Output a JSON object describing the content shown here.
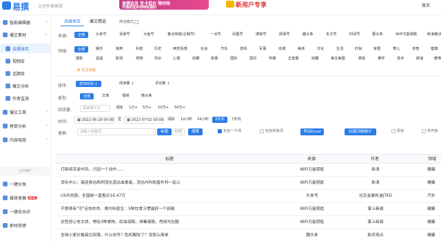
{
  "header": {
    "logo_text": "易撰",
    "slogan": "让创作更高效",
    "banner_line1": "易撰会员 年卡低价 限时抢",
    "banner_line2": "开通即送多项特权福利",
    "banner2_text": "新用户专享",
    "home_link": "首页"
  },
  "sidebar": {
    "items": [
      {
        "label": "智能编辑器",
        "arrow": "›"
      },
      {
        "label": "爆文素材",
        "arrow": "⌄"
      },
      {
        "label": "自媒体库"
      },
      {
        "label": "视频库"
      },
      {
        "label": "话题库"
      },
      {
        "label": "爆文分析"
      },
      {
        "label": "作者监测"
      },
      {
        "label": "爆文工具",
        "arrow": "›"
      },
      {
        "label": "榜单分析",
        "arrow": "›"
      },
      {
        "label": "内容电商",
        "arrow": "›"
      }
    ],
    "section_label": "合作推广",
    "promo_items": [
      {
        "label": "一键分发"
      },
      {
        "label": "媒体发稿",
        "badge": "NEW"
      },
      {
        "label": "一键去水印"
      },
      {
        "label": "即时热榜"
      }
    ]
  },
  "tabs": [
    {
      "label": "自媒体库"
    },
    {
      "label": "爆文精选"
    },
    {
      "label": "简洁模式"
    }
  ],
  "filters": {
    "source_label": "来源:",
    "sources": [
      "全部",
      "头条号",
      "百家号",
      "大鱼号",
      "看点快报(企鹅号)",
      "一点号",
      "凤凰号",
      "搜狐号",
      "网易号",
      "趣头条",
      "东方号",
      "时间号",
      "惠头条",
      "WiFi万能钥匙",
      "新浪看点"
    ],
    "domain_label": "领域:",
    "domains_row1": [
      "全部",
      "娱乐",
      "搞笑",
      "科技",
      "历史",
      "两性情感",
      "社会",
      "汽车",
      "游戏",
      "军事",
      "动漫",
      "美食",
      "文化",
      "生活",
      "时尚",
      "家居",
      "育儿",
      "体育",
      "健康"
    ],
    "domains_row2": [
      "摄影",
      "星座",
      "职场",
      "宠物",
      "风水",
      "心理",
      "收藏",
      "故事",
      "国际",
      "国内",
      "传媒",
      "正能量",
      "收藏",
      "美文美图",
      "移民",
      "佛学",
      "技术",
      "辟谣",
      "教育"
    ],
    "follow_domain": "关注领域",
    "sort_label": "排序:",
    "sorts": [
      "发布时间",
      "阅读量",
      "评论数"
    ],
    "type_label": "类型:",
    "types": [
      "全部",
      "文章",
      "视频",
      "微头条"
    ],
    "read_label": "阅读量:",
    "read_placeholder": "阅读量大于",
    "read_clear": "清除",
    "read_options": [
      "1万+",
      "5万+",
      "10万+",
      "50万+"
    ],
    "time_label": "时间:",
    "time_start": "2022-06-29 00:00",
    "time_sep": "至",
    "time_end": "2022-07-02 00:00",
    "time_clear": "清除",
    "time_options": [
      "12小时",
      "24小时",
      "3天内",
      "7天内"
    ],
    "search_label": "搜索:",
    "search_placeholder": "请输入关键词",
    "search_opt_title": "标题",
    "search_opt_tag": "标签",
    "search_button": "搜索",
    "include_one": "包含一个词",
    "include_all": "包含所有词",
    "export_button": "导出Excel",
    "keyword_stats_button": "标题词频统计",
    "original": "原创",
    "unopened": "未开放"
  },
  "table": {
    "columns": [
      "标题",
      "来源",
      "作者",
      "领域"
    ],
    "rows": [
      {
        "title": "打麻将突发中风，只因一个动作……",
        "source": "WiFi万能钥匙",
        "author": "新浪",
        "domain": "健康"
      },
      {
        "title": "消化中心：接连救治两例消化道出血患者，消化内科和普外科一起上",
        "source": "WiFi万能钥匙",
        "author": "新浪",
        "domain": "健康"
      },
      {
        "title": "C6共创版，全国统一直售价16.47万",
        "source": "头条号",
        "author": "北京金泰凯迪JTKD",
        "domain": "汽车"
      },
      {
        "title": "不想肾有\"守\"走你的命，肾内科医生：5种饮食习惯最好一个别碰",
        "source": "WiFi万能钥匙",
        "author": "掌上新闻",
        "domain": "健康"
      },
      {
        "title": "女性担心老太快、常吃3种食物，刮油润肠，排毒清肠，甩掉大肚腩",
        "source": "WiFi万能钥匙",
        "author": "掌上新闻",
        "domain": "健康"
      },
      {
        "title": "全球小麦价格高位回落，什么信号？危机解除了？没那么简单",
        "source": "趣头条",
        "author": "新农观点",
        "domain": "健康"
      }
    ]
  },
  "colors": {
    "accent": "#2b7de9",
    "warning": "#e98a2b"
  }
}
